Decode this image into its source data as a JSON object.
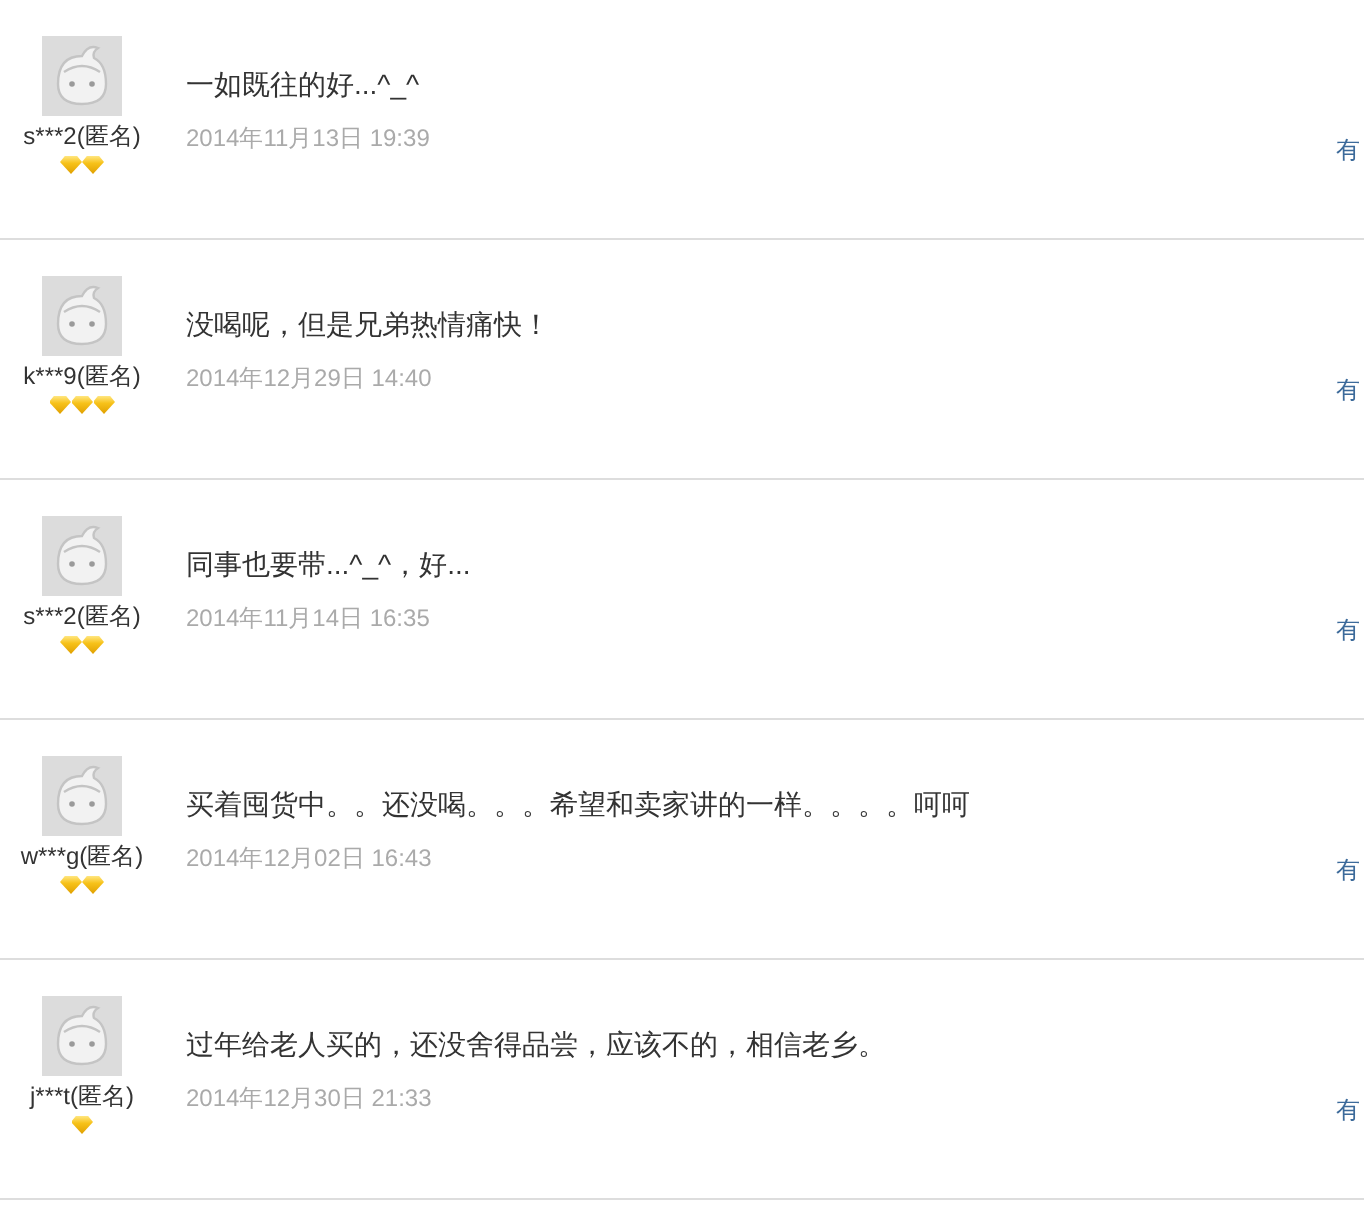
{
  "reviews": [
    {
      "user": "s***2(匿名)",
      "badges": [
        {
          "kind": "diamond"
        },
        {
          "kind": "diamond"
        }
      ],
      "comment": "一如既往的好...^_^",
      "date": "2014年11月13日 19:39",
      "link": "有"
    },
    {
      "user": "k***9(匿名)",
      "badges": [
        {
          "kind": "diamond"
        },
        {
          "kind": "diamond"
        },
        {
          "kind": "diamond"
        }
      ],
      "comment": "没喝呢，但是兄弟热情痛快！",
      "date": "2014年12月29日 14:40",
      "link": "有"
    },
    {
      "user": "s***2(匿名)",
      "badges": [
        {
          "kind": "diamond"
        },
        {
          "kind": "diamond"
        }
      ],
      "comment": "同事也要带...^_^，好...",
      "date": "2014年11月14日 16:35",
      "link": "有"
    },
    {
      "user": "w***g(匿名)",
      "badges": [
        {
          "kind": "diamond"
        },
        {
          "kind": "diamond"
        }
      ],
      "comment": "买着囤货中。。还没喝。。。希望和卖家讲的一样。。。。呵呵",
      "date": "2014年12月02日 16:43",
      "link": "有"
    },
    {
      "user": "j***t(匿名)",
      "badges": [
        {
          "kind": "diamond"
        }
      ],
      "comment": "过年给老人买的，还没舍得品尝，应该不的，相信老乡。",
      "date": "2014年12月30日 21:33",
      "link": "有"
    }
  ]
}
